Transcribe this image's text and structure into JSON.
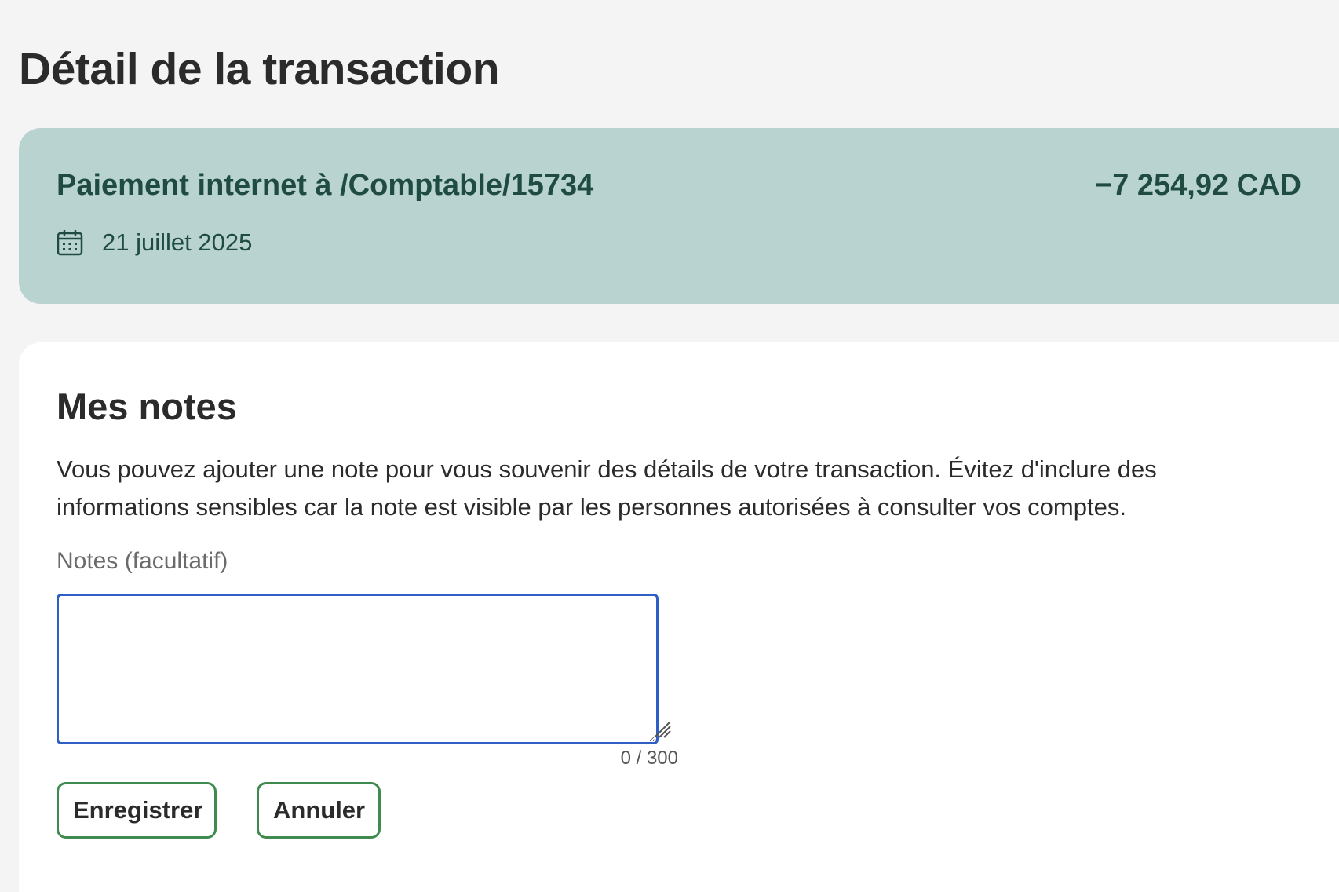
{
  "page": {
    "title": "Détail de la transaction"
  },
  "transaction": {
    "description": "Paiement internet à /Comptable/15734",
    "amount": "−7 254,92 CAD",
    "date": "21 juillet 2025",
    "date_icon": "calendar-icon"
  },
  "notes": {
    "heading": "Mes notes",
    "description": "Vous pouvez ajouter une note pour vous souvenir des détails de votre transaction. Évitez d'inclure des informations sensibles car la note est visible par les personnes autorisées à consulter vos comptes.",
    "field_label": "Notes (facultatif)",
    "field_value": "",
    "counter": "0 / 300"
  },
  "actions": {
    "save_label": "Enregistrer",
    "cancel_label": "Annuler"
  },
  "colors": {
    "page_background": "#f4f4f4",
    "summary_background": "#b9d4d0",
    "summary_text": "#1f4b43",
    "focus_border": "#2f5fc4",
    "button_border": "#3f8a4f"
  }
}
